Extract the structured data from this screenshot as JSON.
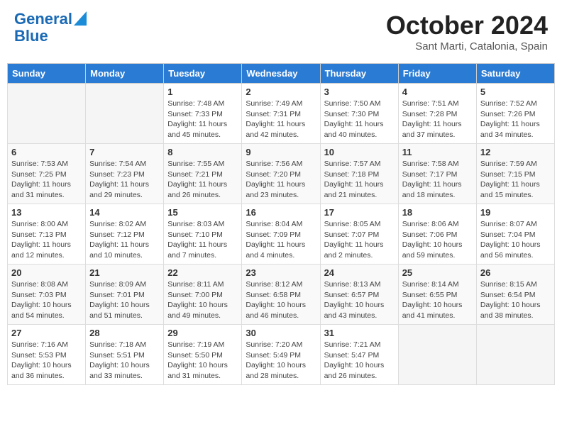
{
  "header": {
    "logo_line1": "General",
    "logo_line2": "Blue",
    "month": "October 2024",
    "location": "Sant Marti, Catalonia, Spain"
  },
  "weekdays": [
    "Sunday",
    "Monday",
    "Tuesday",
    "Wednesday",
    "Thursday",
    "Friday",
    "Saturday"
  ],
  "weeks": [
    [
      {
        "day": "",
        "sunrise": "",
        "sunset": "",
        "daylight": ""
      },
      {
        "day": "",
        "sunrise": "",
        "sunset": "",
        "daylight": ""
      },
      {
        "day": "1",
        "sunrise": "Sunrise: 7:48 AM",
        "sunset": "Sunset: 7:33 PM",
        "daylight": "Daylight: 11 hours and 45 minutes."
      },
      {
        "day": "2",
        "sunrise": "Sunrise: 7:49 AM",
        "sunset": "Sunset: 7:31 PM",
        "daylight": "Daylight: 11 hours and 42 minutes."
      },
      {
        "day": "3",
        "sunrise": "Sunrise: 7:50 AM",
        "sunset": "Sunset: 7:30 PM",
        "daylight": "Daylight: 11 hours and 40 minutes."
      },
      {
        "day": "4",
        "sunrise": "Sunrise: 7:51 AM",
        "sunset": "Sunset: 7:28 PM",
        "daylight": "Daylight: 11 hours and 37 minutes."
      },
      {
        "day": "5",
        "sunrise": "Sunrise: 7:52 AM",
        "sunset": "Sunset: 7:26 PM",
        "daylight": "Daylight: 11 hours and 34 minutes."
      }
    ],
    [
      {
        "day": "6",
        "sunrise": "Sunrise: 7:53 AM",
        "sunset": "Sunset: 7:25 PM",
        "daylight": "Daylight: 11 hours and 31 minutes."
      },
      {
        "day": "7",
        "sunrise": "Sunrise: 7:54 AM",
        "sunset": "Sunset: 7:23 PM",
        "daylight": "Daylight: 11 hours and 29 minutes."
      },
      {
        "day": "8",
        "sunrise": "Sunrise: 7:55 AM",
        "sunset": "Sunset: 7:21 PM",
        "daylight": "Daylight: 11 hours and 26 minutes."
      },
      {
        "day": "9",
        "sunrise": "Sunrise: 7:56 AM",
        "sunset": "Sunset: 7:20 PM",
        "daylight": "Daylight: 11 hours and 23 minutes."
      },
      {
        "day": "10",
        "sunrise": "Sunrise: 7:57 AM",
        "sunset": "Sunset: 7:18 PM",
        "daylight": "Daylight: 11 hours and 21 minutes."
      },
      {
        "day": "11",
        "sunrise": "Sunrise: 7:58 AM",
        "sunset": "Sunset: 7:17 PM",
        "daylight": "Daylight: 11 hours and 18 minutes."
      },
      {
        "day": "12",
        "sunrise": "Sunrise: 7:59 AM",
        "sunset": "Sunset: 7:15 PM",
        "daylight": "Daylight: 11 hours and 15 minutes."
      }
    ],
    [
      {
        "day": "13",
        "sunrise": "Sunrise: 8:00 AM",
        "sunset": "Sunset: 7:13 PM",
        "daylight": "Daylight: 11 hours and 12 minutes."
      },
      {
        "day": "14",
        "sunrise": "Sunrise: 8:02 AM",
        "sunset": "Sunset: 7:12 PM",
        "daylight": "Daylight: 11 hours and 10 minutes."
      },
      {
        "day": "15",
        "sunrise": "Sunrise: 8:03 AM",
        "sunset": "Sunset: 7:10 PM",
        "daylight": "Daylight: 11 hours and 7 minutes."
      },
      {
        "day": "16",
        "sunrise": "Sunrise: 8:04 AM",
        "sunset": "Sunset: 7:09 PM",
        "daylight": "Daylight: 11 hours and 4 minutes."
      },
      {
        "day": "17",
        "sunrise": "Sunrise: 8:05 AM",
        "sunset": "Sunset: 7:07 PM",
        "daylight": "Daylight: 11 hours and 2 minutes."
      },
      {
        "day": "18",
        "sunrise": "Sunrise: 8:06 AM",
        "sunset": "Sunset: 7:06 PM",
        "daylight": "Daylight: 10 hours and 59 minutes."
      },
      {
        "day": "19",
        "sunrise": "Sunrise: 8:07 AM",
        "sunset": "Sunset: 7:04 PM",
        "daylight": "Daylight: 10 hours and 56 minutes."
      }
    ],
    [
      {
        "day": "20",
        "sunrise": "Sunrise: 8:08 AM",
        "sunset": "Sunset: 7:03 PM",
        "daylight": "Daylight: 10 hours and 54 minutes."
      },
      {
        "day": "21",
        "sunrise": "Sunrise: 8:09 AM",
        "sunset": "Sunset: 7:01 PM",
        "daylight": "Daylight: 10 hours and 51 minutes."
      },
      {
        "day": "22",
        "sunrise": "Sunrise: 8:11 AM",
        "sunset": "Sunset: 7:00 PM",
        "daylight": "Daylight: 10 hours and 49 minutes."
      },
      {
        "day": "23",
        "sunrise": "Sunrise: 8:12 AM",
        "sunset": "Sunset: 6:58 PM",
        "daylight": "Daylight: 10 hours and 46 minutes."
      },
      {
        "day": "24",
        "sunrise": "Sunrise: 8:13 AM",
        "sunset": "Sunset: 6:57 PM",
        "daylight": "Daylight: 10 hours and 43 minutes."
      },
      {
        "day": "25",
        "sunrise": "Sunrise: 8:14 AM",
        "sunset": "Sunset: 6:55 PM",
        "daylight": "Daylight: 10 hours and 41 minutes."
      },
      {
        "day": "26",
        "sunrise": "Sunrise: 8:15 AM",
        "sunset": "Sunset: 6:54 PM",
        "daylight": "Daylight: 10 hours and 38 minutes."
      }
    ],
    [
      {
        "day": "27",
        "sunrise": "Sunrise: 7:16 AM",
        "sunset": "Sunset: 5:53 PM",
        "daylight": "Daylight: 10 hours and 36 minutes."
      },
      {
        "day": "28",
        "sunrise": "Sunrise: 7:18 AM",
        "sunset": "Sunset: 5:51 PM",
        "daylight": "Daylight: 10 hours and 33 minutes."
      },
      {
        "day": "29",
        "sunrise": "Sunrise: 7:19 AM",
        "sunset": "Sunset: 5:50 PM",
        "daylight": "Daylight: 10 hours and 31 minutes."
      },
      {
        "day": "30",
        "sunrise": "Sunrise: 7:20 AM",
        "sunset": "Sunset: 5:49 PM",
        "daylight": "Daylight: 10 hours and 28 minutes."
      },
      {
        "day": "31",
        "sunrise": "Sunrise: 7:21 AM",
        "sunset": "Sunset: 5:47 PM",
        "daylight": "Daylight: 10 hours and 26 minutes."
      },
      {
        "day": "",
        "sunrise": "",
        "sunset": "",
        "daylight": ""
      },
      {
        "day": "",
        "sunrise": "",
        "sunset": "",
        "daylight": ""
      }
    ]
  ]
}
